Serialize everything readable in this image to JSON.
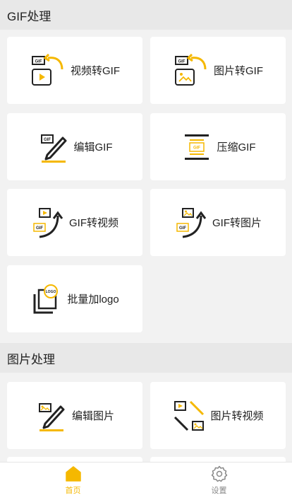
{
  "sections": {
    "gif": {
      "title": "GIF处理",
      "items": [
        {
          "label": "视频转GIF",
          "icon": "video-to-gif-icon"
        },
        {
          "label": "图片转GIF",
          "icon": "image-to-gif-icon"
        },
        {
          "label": "编辑GIF",
          "icon": "edit-gif-icon"
        },
        {
          "label": "压缩GIF",
          "icon": "compress-gif-icon"
        },
        {
          "label": "GIF转视频",
          "icon": "gif-to-video-icon"
        },
        {
          "label": "GIF转图片",
          "icon": "gif-to-image-icon"
        },
        {
          "label": "批量加logo",
          "icon": "batch-logo-icon"
        }
      ]
    },
    "image": {
      "title": "图片处理",
      "items": [
        {
          "label": "编辑图片",
          "icon": "edit-image-icon"
        },
        {
          "label": "图片转视频",
          "icon": "image-to-video-icon"
        }
      ]
    }
  },
  "icon_text": {
    "gif": "GIF",
    "logo": "LOGO"
  },
  "tabbar": {
    "home_label": "首页",
    "settings_label": "设置"
  },
  "colors": {
    "accent": "#f5b800",
    "text": "#222222",
    "section_bg": "#e8e8e8",
    "page_bg": "#f2f2f2"
  }
}
